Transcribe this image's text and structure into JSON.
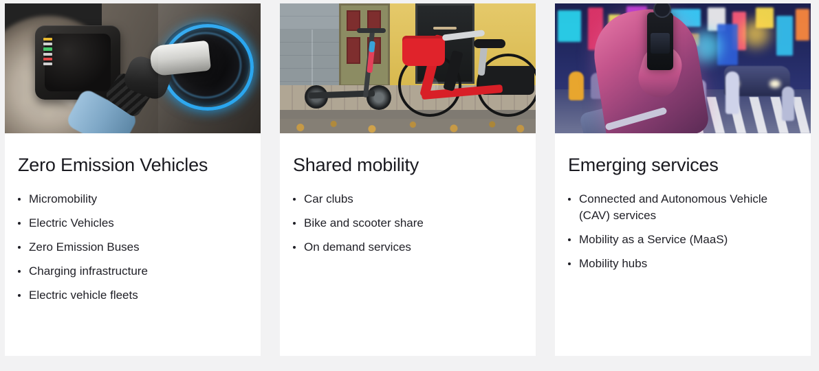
{
  "page": {
    "background_color": "#f2f2f3",
    "card_background_color": "#ffffff",
    "text_color": "#1f1f26",
    "heading_color": "#1a1a20"
  },
  "cards": [
    {
      "id": "zero-emission-vehicles",
      "title": "Zero Emission Vehicles",
      "image_alt": "Electric vehicle charging connector plugged into a car charging port with a blue illuminated ring",
      "items": [
        "Micromobility",
        "Electric Vehicles",
        "Zero Emission Buses",
        "Charging infrastructure",
        "Electric vehicle fleets"
      ]
    },
    {
      "id": "shared-mobility",
      "title": "Shared mobility",
      "image_alt": "A red shared hire bike and an electric scooter parked on a cobbled pavement in front of a building",
      "items": [
        "Car clubs",
        "Bike and scooter share",
        "On demand services"
      ]
    },
    {
      "id": "emerging-services",
      "title": "Emerging services",
      "image_alt": "A hand holding a small gimbal camera in front of a neon lit city street at night with a pedestrian crossing",
      "items": [
        "Connected and Autonomous Vehicle (CAV) services",
        "Mobility as a Service (MaaS)",
        "Mobility hubs"
      ]
    }
  ]
}
